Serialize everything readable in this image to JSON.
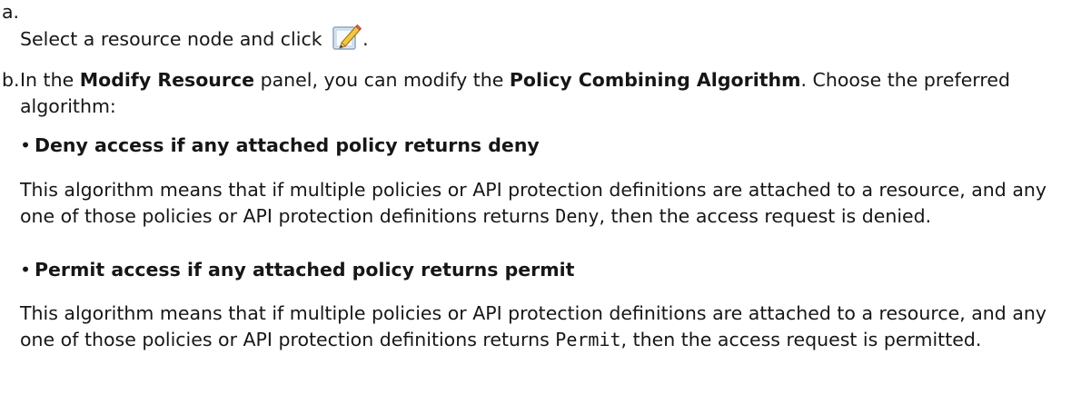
{
  "step_a": {
    "marker": "a.",
    "text": "Select a resource node and click",
    "icon": "edit-icon",
    "trailing": "."
  },
  "step_b": {
    "marker": "b.",
    "pre": "In the ",
    "panel": "Modify Resource",
    "mid": " panel, you can modify the ",
    "field": "Policy Combining Algorithm",
    "post": ". Choose the preferred algorithm:"
  },
  "options": [
    {
      "title": "Deny access if any attached policy returns deny",
      "desc_pre": "This algorithm means that if multiple policies or API protection definitions are attached to a resource, and any one of those policies or API protection definitions returns ",
      "desc_code": "Deny",
      "desc_post": ", then the access request is denied."
    },
    {
      "title": "Permit access if any attached policy returns permit",
      "desc_pre": "This algorithm means that if multiple policies or API protection definitions are attached to a resource, and any one of those policies or API protection definitions returns ",
      "desc_code": "Permit",
      "desc_post": ", then the access request is permitted."
    }
  ],
  "bullet": "•"
}
